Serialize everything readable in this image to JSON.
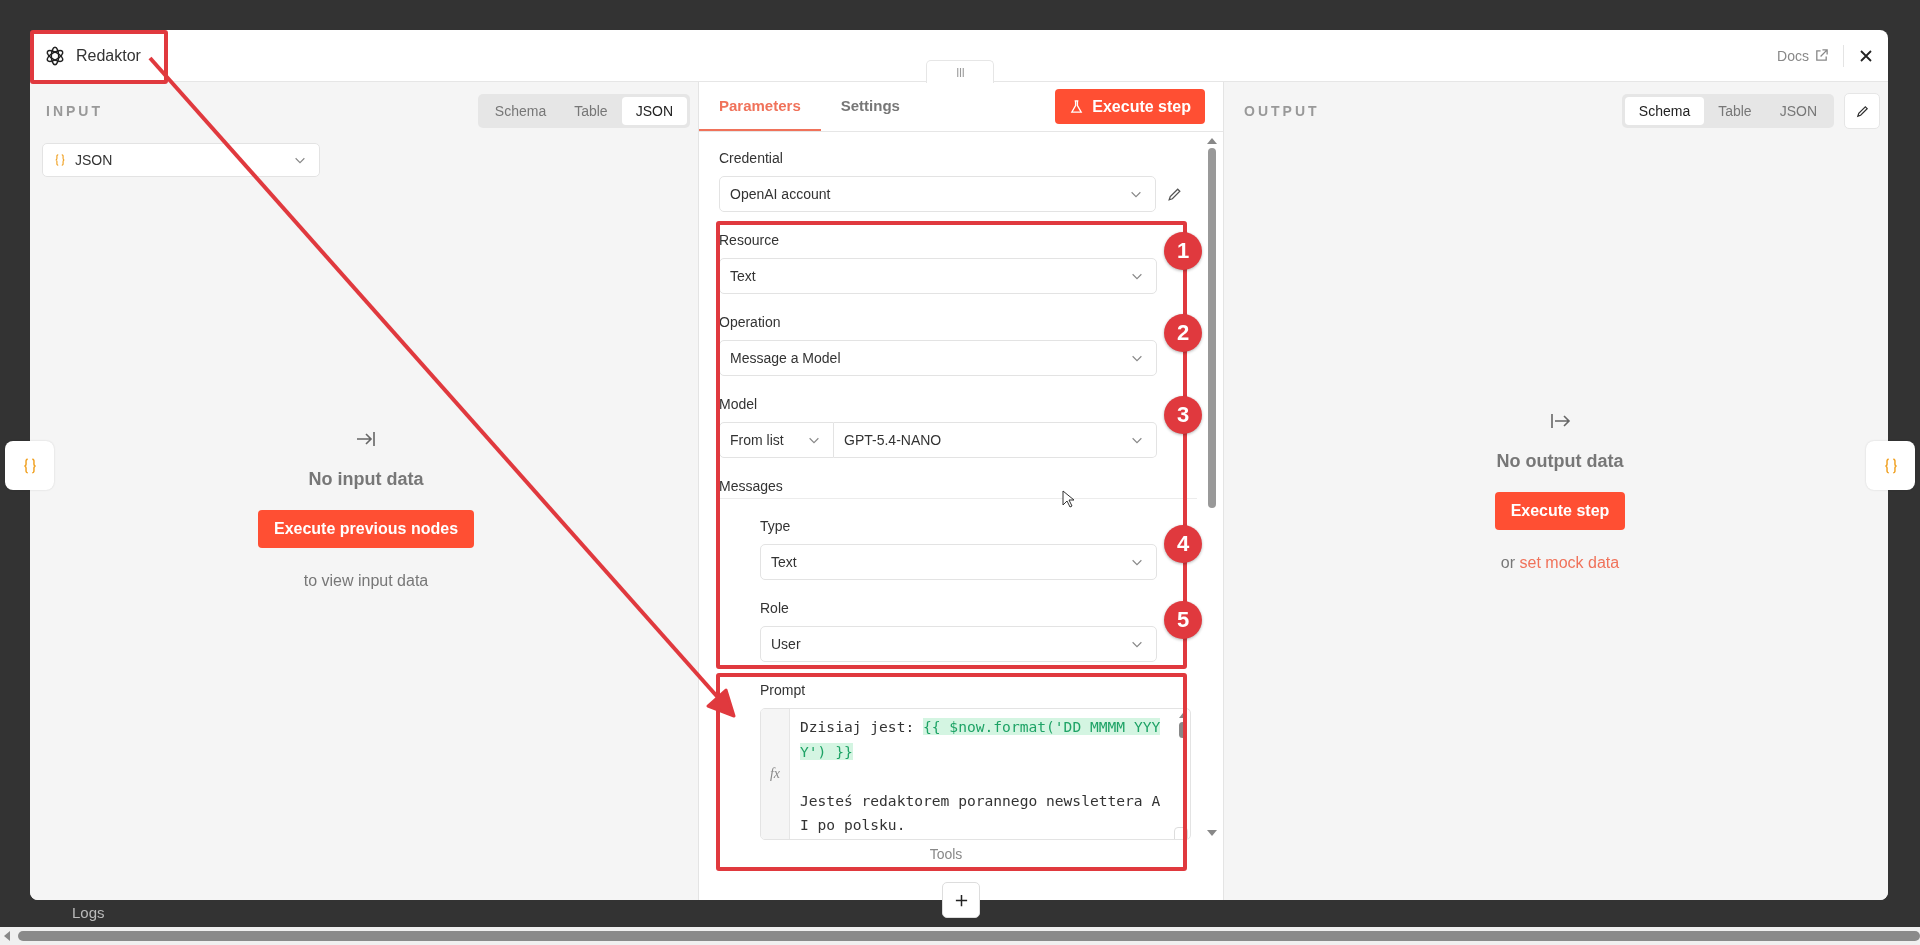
{
  "window": {
    "title": "Redaktor",
    "docs_link": "Docs"
  },
  "input_panel": {
    "label": "INPUT",
    "view_tabs": [
      {
        "label": "Schema",
        "selected": false
      },
      {
        "label": "Table",
        "selected": false
      },
      {
        "label": "JSON",
        "selected": true
      }
    ],
    "format_select": {
      "value": "JSON"
    },
    "empty_title": "No input data",
    "action_button": "Execute previous nodes",
    "hint": "to view input data"
  },
  "node_panel": {
    "tabs": [
      {
        "label": "Parameters",
        "selected": true
      },
      {
        "label": "Settings",
        "selected": false
      }
    ],
    "execute_button": "Execute step",
    "parameters": [
      {
        "kind": "credential",
        "label": "Credential",
        "value": "OpenAI account"
      },
      {
        "kind": "select",
        "label": "Resource",
        "value": "Text"
      },
      {
        "kind": "select",
        "label": "Operation",
        "value": "Message a Model"
      },
      {
        "kind": "model",
        "label": "Model",
        "mode": "From list",
        "value": "GPT-5.4-NANO"
      },
      {
        "kind": "collection",
        "label": "Messages",
        "children": [
          {
            "kind": "select",
            "label": "Type",
            "value": "Text"
          },
          {
            "kind": "select",
            "label": "Role",
            "value": "User"
          },
          {
            "kind": "expression",
            "label": "Prompt",
            "gutter_label": "fx",
            "paragraphs": [
              [
                {
                  "kind": "plain",
                  "text": "Dzisiaj jest: "
                },
                {
                  "kind": "expression",
                  "text": "{{ $now.format('DD MMMM YYYY') }}"
                }
              ],
              [
                {
                  "kind": "plain",
                  "text": "Jesteś redaktorem porannego newslettera AI po polsku."
                }
              ]
            ]
          }
        ]
      },
      {
        "kind": "heading",
        "label": "Tools"
      }
    ]
  },
  "output_panel": {
    "label": "OUTPUT",
    "view_tabs": [
      {
        "label": "Schema",
        "selected": true
      },
      {
        "label": "Table",
        "selected": false
      },
      {
        "label": "JSON",
        "selected": false
      }
    ],
    "empty_title": "No output data",
    "action_button": "Execute step",
    "hint_prefix": "or",
    "hint_link": "set mock data"
  },
  "annotations": [
    "1",
    "2",
    "3",
    "4",
    "5"
  ],
  "footer": {
    "logs_label": "Logs"
  }
}
